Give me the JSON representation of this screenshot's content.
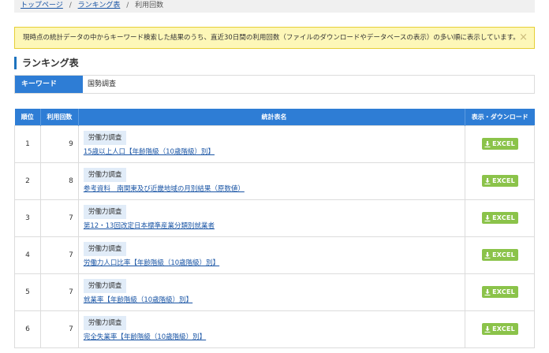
{
  "breadcrumb": {
    "home": "トップページ",
    "ranking": "ランキング表",
    "current": "利用回数",
    "separator": "/"
  },
  "notice": {
    "text": "現時点の統計データの中からキーワード検索した結果のうち、直近30日間の利用回数（ファイルのダウンロードやデータベースの表示）の多い順に表示しています。",
    "close": "×"
  },
  "section": {
    "title": "ランキング表"
  },
  "keyword": {
    "label": "キーワード",
    "value": "国勢調査"
  },
  "table": {
    "headers": {
      "rank": "順位",
      "count": "利用回数",
      "name": "統計表名",
      "download": "表示・ダウンロード"
    },
    "download_label": "EXCEL",
    "rows": [
      {
        "rank": "1",
        "count": "9",
        "survey": "労働力調査",
        "title": "15歳以上人口【年齢階級（10歳階級）別】"
      },
      {
        "rank": "2",
        "count": "8",
        "survey": "労働力調査",
        "title": "参考資料　南関東及び近畿地域の月別結果（原数値）"
      },
      {
        "rank": "3",
        "count": "7",
        "survey": "労働力調査",
        "title": "第12・13回改定日本標準産業分類別就業者"
      },
      {
        "rank": "4",
        "count": "7",
        "survey": "労働力調査",
        "title": "労働力人口比率【年齢階級（10歳階級）別】"
      },
      {
        "rank": "5",
        "count": "7",
        "survey": "労働力調査",
        "title": "就業率【年齢階級（10歳階級）別】"
      },
      {
        "rank": "6",
        "count": "7",
        "survey": "労働力調査",
        "title": "完全失業率【年齢階級（10歳階級）別】"
      }
    ]
  },
  "colors": {
    "header_blue": "#2e7dd5",
    "excel_green": "#8bc34a",
    "notice_bg": "#fdf7b8",
    "link": "#1a55a5"
  }
}
